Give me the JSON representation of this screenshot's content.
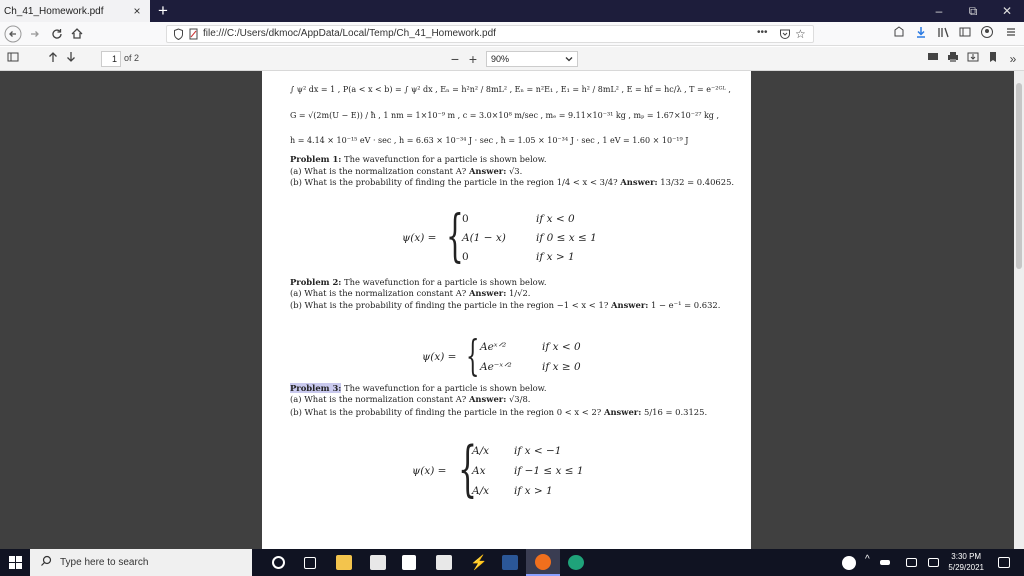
{
  "tab": {
    "title": "Ch_41_Homework.pdf",
    "close": "×"
  },
  "newtab": "+",
  "window": {
    "minimize": "–",
    "restore": "⧉",
    "close": "✕"
  },
  "nav": {
    "url": "file:///C:/Users/dkmoc/AppData/Local/Temp/Ch_41_Homework.pdf",
    "more": "•••"
  },
  "pdf": {
    "page_value": "1",
    "page_of": "of 2",
    "zoom": "90%"
  },
  "doc": {
    "eq_line1": "∫ ψ² dx = 1 , P(a < x < b) = ∫ ψ² dx , Eₙ = h²n² / 8mL² , Eₙ = n²E₁ , E₁ = h² / 8mL² , E = hf = hc/λ , T = e⁻²ᴳᴸ ,",
    "eq_line2": "G = √(2m(U − E)) / ħ , 1 nm = 1×10⁻⁹ m , c = 3.0×10⁸ m/sec , mₑ = 9.11×10⁻³¹ kg , mₚ = 1.67×10⁻²⁷ kg ,",
    "eq_line3": "h = 4.14 × 10⁻¹⁵ eV · sec , h = 6.63 × 10⁻³⁴ J · sec , ħ = 1.05 × 10⁻³⁴ J · sec , 1 eV = 1.60 × 10⁻¹⁹ J",
    "p1_title": "Problem 1:",
    "p1_text": "The wavefunction for a particle is shown below.",
    "p1_a": "(a) What is the normalization constant A?",
    "p1_a_ans_label": "Answer:",
    "p1_a_ans": "√3.",
    "p1_b": "(b) What is the probability of finding the particle in the region 1/4 < x < 3/4?",
    "p1_b_ans_label": "Answer:",
    "p1_b_ans": "13/32 = 0.40625.",
    "p1_eq_lhs": "ψ(x) =",
    "p1_cases": [
      "0",
      "A(1 − x)",
      "0"
    ],
    "p1_conds": [
      "if x < 0",
      "if 0 ≤ x ≤ 1",
      "if x > 1"
    ],
    "p2_title": "Problem 2:",
    "p2_text": "The wavefunction for a particle is shown below.",
    "p2_a": "(a) What is the normalization constant A?",
    "p2_a_ans_label": "Answer:",
    "p2_a_ans": "1/√2.",
    "p2_b": "(b) What is the probability of finding the particle in the region −1 < x < 1?",
    "p2_b_ans_label": "Answer:",
    "p2_b_ans": "1 − e⁻¹ = 0.632.",
    "p2_eq_lhs": "ψ(x) =",
    "p2_cases": [
      "Aeˣᐟ²",
      "Ae⁻ˣᐟ²"
    ],
    "p2_conds": [
      "if x < 0",
      "if x ≥ 0"
    ],
    "p3_title": "Problem 3:",
    "p3_text": "The wavefunction for a particle is shown below.",
    "p3_a": "(a) What is the normalization constant A?",
    "p3_a_ans_label": "Answer:",
    "p3_a_ans": "√3/8.",
    "p3_b": "(b) What is the probability of finding the particle in the region 0 < x < 2?",
    "p3_b_ans_label": "Answer:",
    "p3_b_ans": "5/16 = 0.3125.",
    "p3_eq_lhs": "ψ(x) =",
    "p3_cases": [
      "A/x",
      "Ax",
      "A/x"
    ],
    "p3_conds": [
      "if x < −1",
      "if −1 ≤ x ≤ 1",
      "if x > 1"
    ]
  },
  "taskbar": {
    "search_placeholder": "Type here to search",
    "time": "3:30 PM",
    "date": "5/29/2021"
  },
  "colors": {
    "tabstrip": "#1d1d3b",
    "taskbar": "#101322",
    "viewer_bg": "#404040",
    "highlight": "#c9c9ee"
  }
}
